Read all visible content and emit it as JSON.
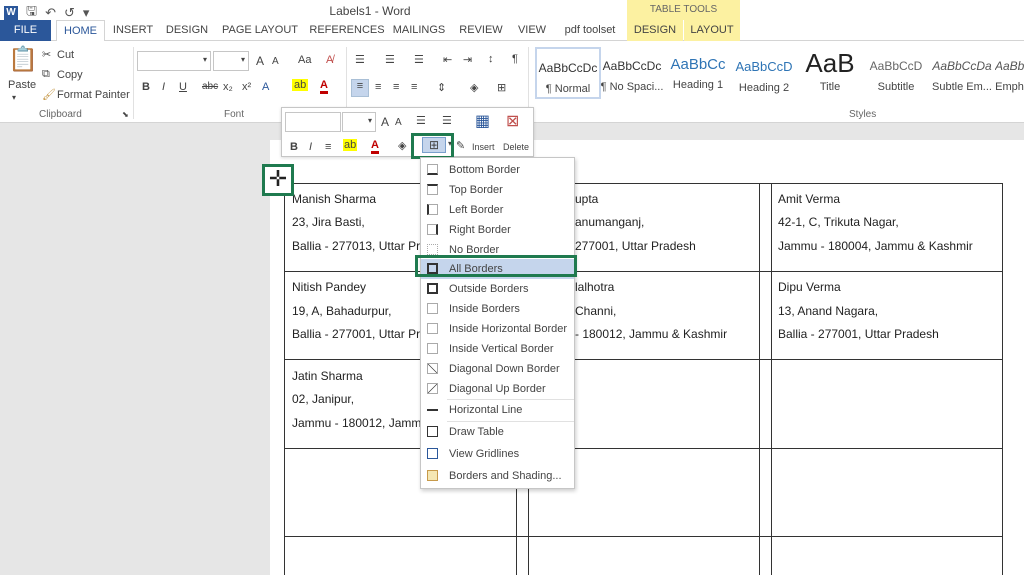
{
  "window": {
    "title": "Labels1 - Word",
    "table_tools_label": "TABLE TOOLS"
  },
  "tabs": {
    "file": "FILE",
    "home": "HOME",
    "insert": "INSERT",
    "design": "DESIGN",
    "page_layout": "PAGE LAYOUT",
    "references": "REFERENCES",
    "mailings": "MAILINGS",
    "review": "REVIEW",
    "view": "VIEW",
    "pdf_toolset": "pdf toolset",
    "tt_design": "DESIGN",
    "tt_layout": "LAYOUT"
  },
  "clipboard": {
    "paste": "Paste",
    "cut": "Cut",
    "copy": "Copy",
    "format_painter": "Format Painter",
    "label": "Clipboard"
  },
  "font_group": {
    "label": "Font",
    "bold": "B",
    "italic": "I",
    "underline": "U",
    "strike": "abc",
    "sub": "x₂",
    "sup": "x²",
    "grow": "A",
    "shrink": "A",
    "case": "Aa",
    "highlight": "ab",
    "color": "A"
  },
  "styles_group": {
    "label": "Styles",
    "items": [
      {
        "preview": "AaBbCcDc",
        "name": "¶ Normal",
        "color": "#333333"
      },
      {
        "preview": "AaBbCcDc",
        "name": "¶ No Spaci...",
        "color": "#333333"
      },
      {
        "preview": "AaBbCc",
        "name": "Heading 1",
        "color": "#2e74b5"
      },
      {
        "preview": "AaBbCcD",
        "name": "Heading 2",
        "color": "#2e74b5"
      },
      {
        "preview": "AaB",
        "name": "Title",
        "color": "#222222"
      },
      {
        "preview": "AaBbCcD",
        "name": "Subtitle",
        "color": "#666666"
      },
      {
        "preview": "AaBbCcDa",
        "name": "Subtle Em...",
        "color": "#555555"
      },
      {
        "preview": "AaBbCcDa",
        "name": "Emph",
        "color": "#555555"
      }
    ]
  },
  "mini_toolbar": {
    "insert": "Insert",
    "delete": "Delete",
    "bold": "B",
    "italic": "I"
  },
  "borders_menu": {
    "items": [
      {
        "label": "Bottom Border"
      },
      {
        "label": "Top Border"
      },
      {
        "label": "Left Border"
      },
      {
        "label": "Right Border"
      },
      {
        "label": "No Border"
      },
      {
        "label": "All Borders"
      },
      {
        "label": "Outside Borders"
      },
      {
        "label": "Inside Borders"
      },
      {
        "label": "Inside Horizontal Border"
      },
      {
        "label": "Inside Vertical Border"
      },
      {
        "label": "Diagonal Down Border"
      },
      {
        "label": "Diagonal Up Border"
      },
      {
        "label": "Horizontal Line"
      },
      {
        "label": "Draw Table"
      },
      {
        "label": "View Gridlines"
      },
      {
        "label": "Borders and Shading..."
      }
    ],
    "selected": "All Borders"
  },
  "labels": {
    "r1c1": [
      "Manish Sharma",
      "23, Jira Basti,",
      "Ballia - 277013, Uttar Pr"
    ],
    "r1c2": [
      "upta",
      "anumanganj,",
      "277001, Uttar Pradesh"
    ],
    "r1c3": [
      "Amit  Verma",
      "42-1, C, Trikuta Nagar,",
      "Jammu - 180004, Jammu & Kashmir"
    ],
    "r2c1": [
      "Nitish Pandey",
      "19, A, Bahadurpur,",
      "Ballia - 277001, Uttar Pr"
    ],
    "r2c2": [
      "lalhotra",
      "Channi,",
      "- 180012, Jammu & Kashmir"
    ],
    "r2c3": [
      "Dipu  Verma",
      "13, Anand Nagara,",
      "Ballia - 277001, Uttar Pradesh"
    ],
    "r3c1": [
      "Jatin Sharma",
      "02, Janipur,",
      "Jammu - 180012, Jamm"
    ]
  },
  "colors": {
    "accent": "#2b579a",
    "highlight_box": "#1f7a4f",
    "table_tools": "#fcf1a1"
  }
}
